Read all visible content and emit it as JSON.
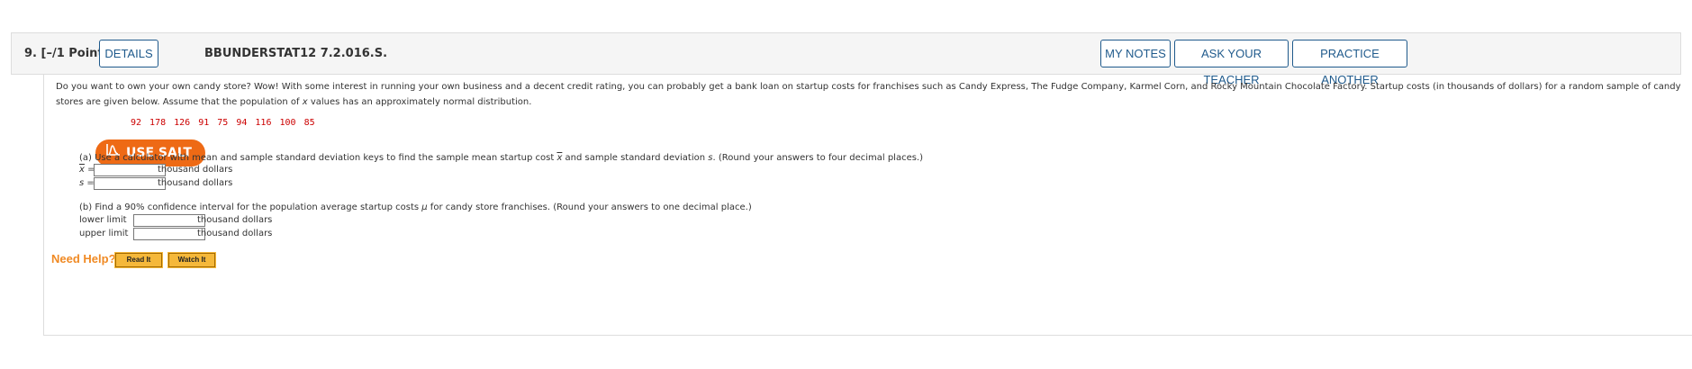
{
  "header": {
    "question_number": "9. [–/1 Points]",
    "details_label": "DETAILS",
    "problem_code": "BBUNDERSTAT12 7.2.016.S.",
    "my_notes_label": "MY NOTES",
    "ask_teacher_label": "ASK YOUR TEACHER",
    "practice_another_label": "PRACTICE ANOTHER"
  },
  "problem": {
    "text_line1": "Do you want to own your own candy store? Wow! With some interest in running your own business and a decent credit rating, you can probably get a bank loan on startup costs for franchises such as Candy Express, The Fudge Company, Karmel Corn, and Rocky Mountain Chocolate Factory. Startup costs (in thousands of dollars) for a random",
    "text_line2a": "sample of candy stores are given below. Assume that the population of ",
    "text_line2_var": "x",
    "text_line2b": " values has an approximately normal distribution.",
    "data_values": "92  178  126  91  75  94  116  100  85"
  },
  "salt_button_label": "USE SALT",
  "part_a": {
    "instruction_a": "(a) Use a calculator with mean and sample standard deviation keys to find the sample mean startup cost ",
    "instruction_var1": "x",
    "instruction_b": " and sample standard deviation ",
    "instruction_var2": "s",
    "instruction_c": ". (Round your answers to four decimal places.)",
    "xbar_label": "x",
    "s_label": "s",
    "unit": "thousand dollars"
  },
  "part_b": {
    "instruction_a": "(b) Find a 90% confidence interval for the population average startup costs ",
    "instruction_mu": "μ",
    "instruction_b": " for candy store franchises. (Round your answers to one decimal place.)",
    "lower_label": "lower limit",
    "upper_label": "upper limit",
    "unit": "thousand dollars"
  },
  "help": {
    "need_help_label": "Need Help?",
    "read_it_label": "Read It",
    "watch_it_label": "Watch It"
  },
  "colors": {
    "accent_blue": "#1f5a8c",
    "salt_orange": "#ee6a15",
    "data_red": "#cc0000",
    "help_orange": "#f08a24"
  }
}
